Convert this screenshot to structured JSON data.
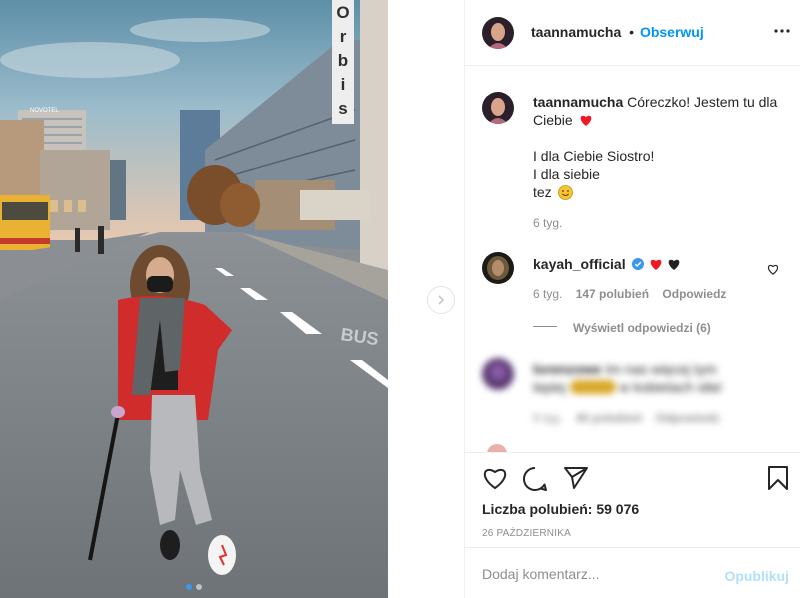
{
  "post": {
    "username": "taannamucha",
    "follow_label": "Obserwuj",
    "separator": "•",
    "more_label": "•••",
    "caption": {
      "username": "taannamucha",
      "line1": "Córeczko! Jestem tu dla",
      "line2": "Ciebie",
      "line3": "I dla Ciebie Siostro!",
      "line4": "I dla siebie",
      "line5": "tez",
      "time": "6 tyg."
    },
    "comments": [
      {
        "username": "kayah_official",
        "verified": true,
        "time": "6 tyg.",
        "likes": "147 polubień",
        "reply_label": "Odpowiedz",
        "view_replies": "Wyświetl odpowiedzi (6)"
      },
      {
        "username": "lorenzowe",
        "text_line1": "Im nas więcej tym",
        "text_line2": "lepiej",
        "text_line2_tail": "w kobietach siła!",
        "time": "6 tyg.",
        "likes": "40 polubień",
        "reply_label": "Odpowiedz"
      }
    ],
    "likes_text": "Liczba polubień: 59 076",
    "date": "26 PAŹDZIERNIKA",
    "comment_placeholder": "Dodaj komentarz...",
    "post_button": "Opublikuj"
  },
  "photo": {
    "sign_letters": [
      "O",
      "r",
      "b",
      "i",
      "s"
    ],
    "hotel_sign": "NOVOTEL",
    "road_text": "BUS"
  },
  "colors": {
    "accent": "#0095f6",
    "text": "#262626",
    "muted": "#8e8e8e",
    "heart_red": "#ed1c24",
    "verified": "#3897f0",
    "post_disabled": "#b2dffc"
  },
  "icons": {
    "like": "heart-outline-icon",
    "comment": "speech-bubble-icon",
    "share": "paper-plane-icon",
    "save": "bookmark-icon",
    "next": "chevron-right-icon",
    "more": "ellipsis-icon"
  }
}
